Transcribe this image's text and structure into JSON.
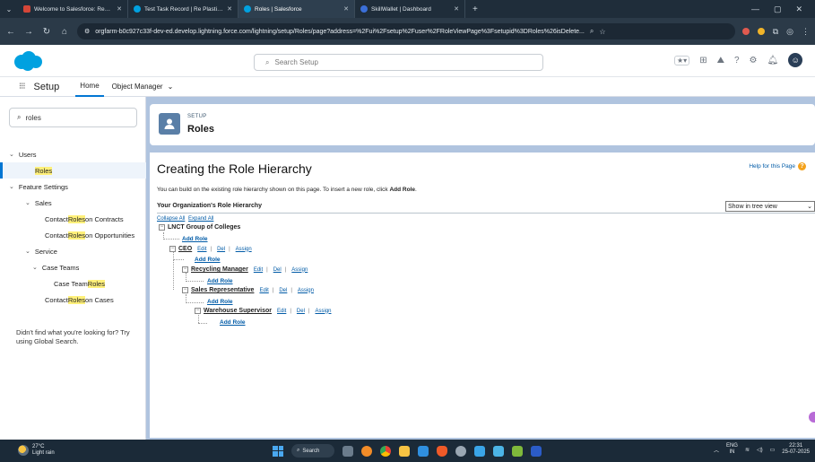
{
  "browser": {
    "tabs": [
      {
        "label": "Welcome to Salesforce: Reset you",
        "color": "#d44638"
      },
      {
        "label": "Test Task Record | Re Plastic Innov",
        "color": "#00a1e0"
      },
      {
        "label": "Roles | Salesforce",
        "color": "#00a1e0",
        "active": true
      },
      {
        "label": "SkillWallet | Dashboard",
        "color": "#3b6fd8"
      }
    ],
    "url": "orgfarm-b0c927c33f-dev-ed.develop.lightning.force.com/lightning/setup/Roles/page?address=%2Fui%2Fsetup%2Fuser%2FRoleViewPage%3Fsetupid%3DRoles%26isDelete..."
  },
  "header": {
    "search_placeholder": "Search Setup"
  },
  "setup_nav": {
    "title": "Setup",
    "tab_home": "Home",
    "tab_object_manager": "Object Manager"
  },
  "sidebar": {
    "quick_find_value": "roles",
    "users": "Users",
    "roles": "Roles",
    "feature_settings": "Feature Settings",
    "sales": "Sales",
    "contact_pre": "Contact ",
    "roles_hl": "Roles",
    "on_contracts": " on Contracts",
    "on_opportunities": " on Opportunities",
    "service": "Service",
    "case_teams": "Case Teams",
    "case_team_pre": "Case Team ",
    "on_cases": " on Cases",
    "note": "Didn't find what you're looking for? Try using Global Search."
  },
  "banner": {
    "setup_label": "SETUP",
    "title": "Roles"
  },
  "content": {
    "page_title": "Creating the Role Hierarchy",
    "help_link": "Help for this Page",
    "intro_text": "You can build on the existing role hierarchy shown on this page. To insert a new role, click ",
    "intro_bold": "Add Role",
    "intro_end": ".",
    "hierarchy_title": "Your Organization's Role Hierarchy",
    "view_select": "Show in tree view",
    "collapse_all": "Collapse All",
    "expand_all": "Expand All",
    "add_role": "Add Role",
    "edit": "Edit",
    "del": "Del",
    "assign": "Assign",
    "sep": "|",
    "roles": {
      "root": "LNCT Group of Colleges",
      "ceo": "CEO",
      "recycling": "Recycling Manager",
      "sales_rep": "Sales Representative",
      "warehouse": "Warehouse Supervisor"
    }
  },
  "taskbar": {
    "temp": "27°C",
    "weather": "Light rain",
    "search": "Search",
    "lang1": "ENG",
    "lang2": "IN",
    "time": "22:31",
    "date": "25-07-2025"
  }
}
